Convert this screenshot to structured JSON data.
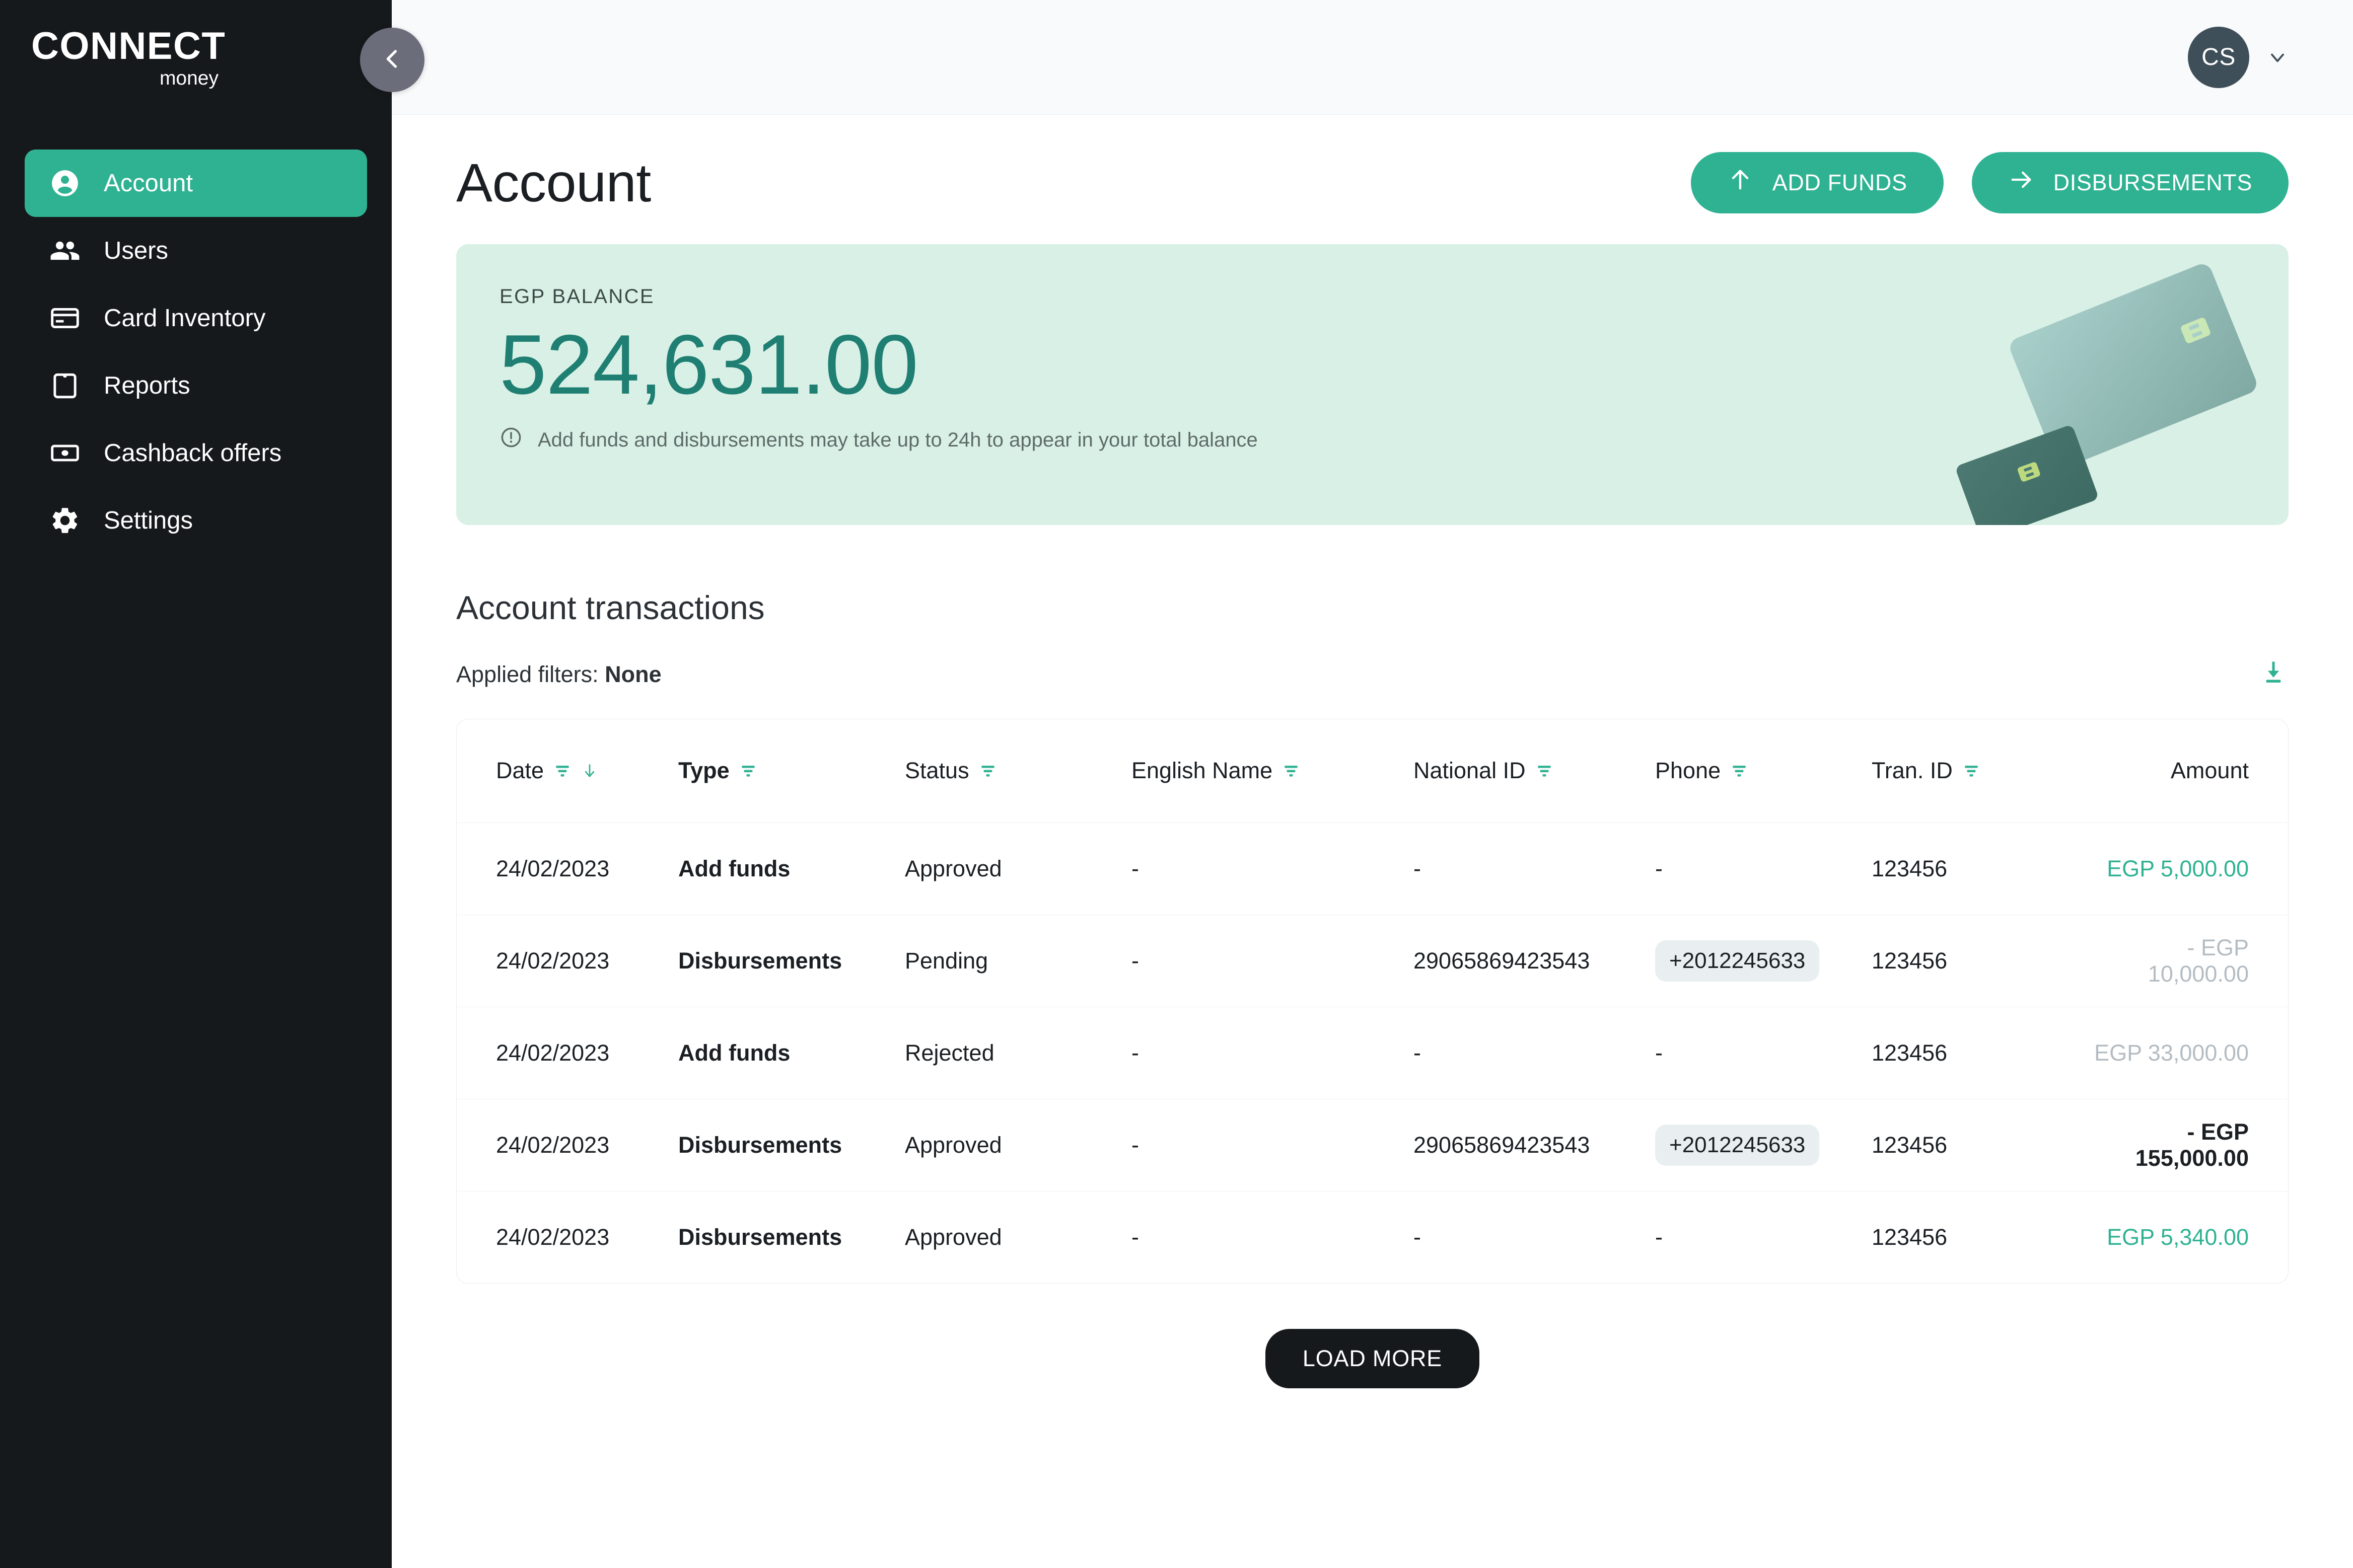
{
  "brand": {
    "name": "CONNECT",
    "tagline": "money"
  },
  "sidebar": {
    "collapse_icon": "chevron-left-icon",
    "items": [
      {
        "label": "Account",
        "icon": "account-circle-icon",
        "active": true
      },
      {
        "label": "Users",
        "icon": "people-icon",
        "active": false
      },
      {
        "label": "Card Inventory",
        "icon": "credit-card-icon",
        "active": false
      },
      {
        "label": "Reports",
        "icon": "clipboard-icon",
        "active": false
      },
      {
        "label": "Cashback offers",
        "icon": "banknote-icon",
        "active": false
      },
      {
        "label": "Settings",
        "icon": "gear-icon",
        "active": false
      }
    ]
  },
  "topbar": {
    "avatar_initials": "CS",
    "dropdown_icon": "chevron-down-icon"
  },
  "page": {
    "title": "Account"
  },
  "actions": {
    "add_funds": {
      "label": "ADD FUNDS",
      "icon": "arrow-up-icon"
    },
    "disbursements": {
      "label": "DISBURSEMENTS",
      "icon": "arrow-right-icon"
    }
  },
  "balance": {
    "label": "EGP BALANCE",
    "amount": "524,631.00",
    "note": "Add funds and disbursements may take up to 24h to appear in your total balance",
    "note_icon": "alert-circle-icon"
  },
  "transactions": {
    "section_title": "Account transactions",
    "applied_filters_label": "Applied filters:",
    "applied_filters_value": "None",
    "download_icon": "download-icon",
    "columns": [
      {
        "label": "Date",
        "filter": true,
        "sorted": true
      },
      {
        "label": "Type",
        "filter": true,
        "sorted": false
      },
      {
        "label": "Status",
        "filter": true,
        "sorted": false
      },
      {
        "label": "English Name",
        "filter": true,
        "sorted": false
      },
      {
        "label": "National ID",
        "filter": true,
        "sorted": false
      },
      {
        "label": "Phone",
        "filter": true,
        "sorted": false
      },
      {
        "label": "Tran. ID",
        "filter": true,
        "sorted": false
      },
      {
        "label": "Amount",
        "filter": false,
        "sorted": false
      }
    ],
    "rows": [
      {
        "date": "24/02/2023",
        "type": "Add funds",
        "status": "Approved",
        "english_name": "-",
        "national_id": "-",
        "phone": "-",
        "tran_id": "123456",
        "amount": "EGP 5,000.00",
        "amount_style": "green"
      },
      {
        "date": "24/02/2023",
        "type": "Disbursements",
        "status": "Pending",
        "english_name": "-",
        "national_id": "29065869423543",
        "phone": "+2012245633",
        "tran_id": "123456",
        "amount": "- EGP 10,000.00",
        "amount_style": "grey"
      },
      {
        "date": "24/02/2023",
        "type": "Add funds",
        "status": "Rejected",
        "english_name": "-",
        "national_id": "-",
        "phone": "-",
        "tran_id": "123456",
        "amount": "EGP 33,000.00",
        "amount_style": "grey"
      },
      {
        "date": "24/02/2023",
        "type": "Disbursements",
        "status": "Approved",
        "english_name": "-",
        "national_id": "29065869423543",
        "phone": "+2012245633",
        "tran_id": "123456",
        "amount": "- EGP 155,000.00",
        "amount_style": "dark"
      },
      {
        "date": "24/02/2023",
        "type": "Disbursements",
        "status": "Approved",
        "english_name": "-",
        "national_id": "-",
        "phone": "-",
        "tran_id": "123456",
        "amount": "EGP 5,340.00",
        "amount_style": "green"
      }
    ],
    "load_more_label": "LOAD MORE"
  },
  "colors": {
    "accent_green": "#2fb292",
    "sidebar_bg": "#16191c",
    "balance_card_bg": "#d9f0e6",
    "balance_text": "#1e7f72",
    "avatar_bg": "#3f4f5a"
  }
}
